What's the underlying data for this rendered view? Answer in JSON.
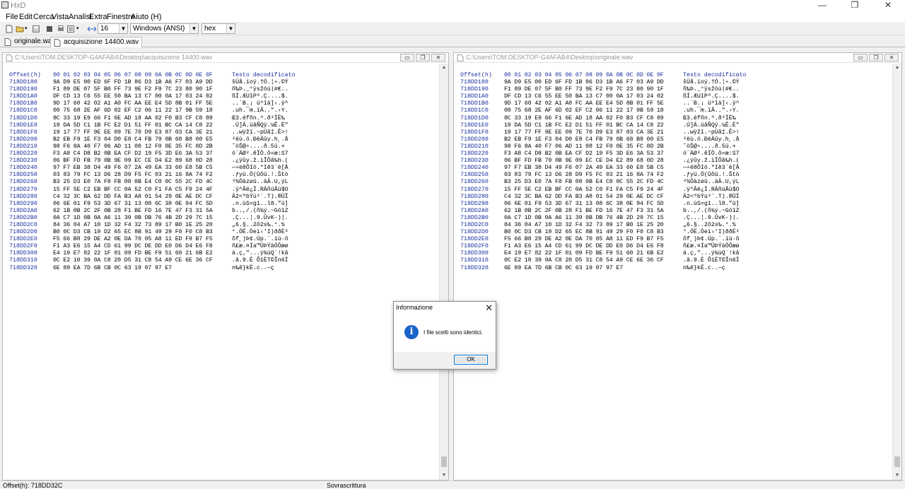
{
  "window": {
    "title": "HxD",
    "minimize": "—",
    "maximize": "❐",
    "close": "✕"
  },
  "menu": [
    "File",
    "Edit",
    "Cerca",
    "Vista",
    "Analisi",
    "Extra",
    "Finestre",
    "Aiuto (H)"
  ],
  "toolbar": {
    "bytes_per_row": "16",
    "charset": "Windows (ANSI)",
    "offset_base": "hex"
  },
  "tabs": [
    {
      "label": "originale.wav",
      "active": false
    },
    {
      "label": "acquisizione 14400.wav",
      "active": true
    }
  ],
  "panes": {
    "left": {
      "path": "C:\\Users\\TOM.DESKTOP-G4AFAB4\\Desktop\\acquisizione 14400.wav"
    },
    "right": {
      "path": "C:\\Users\\TOM.DESKTOP-G4AFAB4\\Desktop\\originale.wav"
    }
  },
  "hex_header": {
    "offset": "Offset(h)",
    "columns": "00 01 02 03 04 05 06 07 08 09 0A 0B 0C 0D 0E 0F",
    "text": "Testo decodificato"
  },
  "hex_rows": [
    {
      "offset": "718DD180",
      "bytes": "9A D9 E5 00 ED 6F FD 1B 86 D3 1B A6 F7 03 A9 DD",
      "text": "šÙå.íoý.†Ó.¦÷.©Ý"
    },
    {
      "offset": "718DD190",
      "bytes": "F1 89 DE 07 5F B0 FF 73 9E F2 F9 7C 23 80 90 1F",
      "text": "ñ‰Þ._°ÿsžòù|#€.."
    },
    {
      "offset": "718DD1A0",
      "bytes": "DF CD 13 C6 55 EE 50 BA 13 C7 00 0A 17 03 24 02",
      "text": "ßÍ.ÆUîPº.Ç....$."
    },
    {
      "offset": "718DD1B0",
      "bytes": "9D 17 60 42 02 A1 A0 FC AA EE E4 5D 8B 01 FF 5E",
      "text": "..`B.¡ üªîä]‹.ÿ^"
    },
    {
      "offset": "718DD1C0",
      "bytes": "00 75 68 2E AF 6D 02 EF C2 06 11 22 17 9B 59 18",
      "text": ".uh.¯m.ïÂ..\".›Y."
    },
    {
      "offset": "718DD1D0",
      "bytes": "8C 33 19 E9 66 F1 6E AD 18 AA 02 F0 B3 CF C8 89",
      "text": "Œ3.éfñn­.ª.ð³ÏÈ‰"
    },
    {
      "offset": "718DD1E0",
      "bytes": "19 DA 5D C1 1B FC E2 D1 51 FF 01 BC CA 14 C8 22",
      "text": ".Ú]Á.üâÑQÿ.¼Ê.È\""
    },
    {
      "offset": "718DD1F0",
      "bytes": "19 17 77 FF 9E EE 09 7E 70 D9 E3 87 03 CA 3E 21",
      "text": "..wÿžî.~pÙã‡.Ê>!"
    },
    {
      "offset": "718DD200",
      "bytes": "B2 EB F9 1E F3 04 D0 E8 C4 FB 79 0B 68 B8 00 E5",
      "text": "²ëù.ó.ÐèÄûy.h¸.å"
    },
    {
      "offset": "718DD210",
      "bytes": "98 F6 8A 40 F7 06 AD 11 08 12 F0 0E 35 FC 8D 2B",
      "text": "˜öŠ@÷.­...ð.5ü.+"
    },
    {
      "offset": "718DD220",
      "bytes": "F3 A8 C4 D8 B2 0B EA CF D2 19 F5 3D E6 3A 53 37",
      "text": "ó¨ÄØ².êÏÒ.õ=æ:S7"
    },
    {
      "offset": "718DD230",
      "bytes": "06 BF FD FB 79 0B 9E 09 EC CE D4 E2 89 68 0D 28",
      "text": ".¿ýûy.ž.ìÎÔâ‰h.("
    },
    {
      "offset": "718DD240",
      "bytes": "97 F7 EB 38 D4 49 F6 07 2A 49 EA 33 60 E8 5B C5",
      "text": "—÷ë8ÔIö.*Iê3`è[Å"
    },
    {
      "offset": "718DD250",
      "bytes": "03 83 79 FC 13 D6 28 D9 F5 FC 03 21 16 8A 74 F2",
      "text": ".ƒyü.Ö(Ùõü.!.Štò"
    },
    {
      "offset": "718DD260",
      "bytes": "B3 25 D3 E0 7A F8 FB 08 0B E4 C0 0C 55 2C FD 4C",
      "text": "³%Óàzøû..äÀ.U,ýL"
    },
    {
      "offset": "718DD270",
      "bytes": "15 FF 5E C2 EB BF CC 0A 52 C0 F1 FA C5 F9 24 4F",
      "text": ".ÿ^Âë¿Ì.RÀñúÅù$O"
    },
    {
      "offset": "718DD280",
      "bytes": "C4 32 3C BA 62 DD FA B3 A8 01 54 29 0E AE DC CF",
      "text": "Ä2<ºbÝú³¨.T).®ÜÏ"
    },
    {
      "offset": "718DD290",
      "bytes": "06 6E 01 F9 53 3D 67 31 13 08 6C 38 0E 94 FC 5D",
      "text": ".n.ùS=g1..l8.”ü]"
    },
    {
      "offset": "718DD2A0",
      "bytes": "62 1B 0B 2C 2F 0B 28 F1 BE FD 16 7E 47 F3 31 5A",
      "text": "b..,/.(ñ¾ý.~Gó1Z"
    },
    {
      "offset": "718DD2B0",
      "bytes": "0A C7 1D 0B 0A A6 11 39 0B DB 76 4B 2D 29 7C 15",
      "text": ".Ç...¦.9.ÛvK-)|."
    },
    {
      "offset": "718DD2C0",
      "bytes": "84 36 04 A7 10 1D 32 F4 32 73 89 17 B0 1E 25 20",
      "text": "„6.§..2ô2s‰.°.% "
    },
    {
      "offset": "718DD2D0",
      "bytes": "B0 0C D3 CB 19 D2 65 EC 8B 91 49 29 F0 F0 C8 B3",
      "text": "°.ÓË.Òeì‹'I)ððÈ³"
    },
    {
      "offset": "718DD2E0",
      "bytes": "F5 66 B8 29 DE A2 0E DA 70 05 A8 11 ED F9 B7 F5",
      "text": "õf¸)Þ¢.Úp.¨.íù·õ"
    },
    {
      "offset": "718DD2F0",
      "bytes": "F1 A3 E6 15 A4 CD 61 99 DC DE DD E0 D6 D4 E6 F8",
      "text": "ñ£æ.¤Ía™ÜÞÝàÖÔæø"
    },
    {
      "offset": "718DD300",
      "bytes": "E4 19 E7 82 22 1F 01 09 FD BE F9 51 60 21 6B E2",
      "text": "ä.ç‚\"...ý¾ùQ`!kâ"
    },
    {
      "offset": "718DD310",
      "bytes": "0C E2 10 39 0A C8 20 D5 31 C8 54 A9 CE 6E 36 CF",
      "text": ".â.9.È Õ1ÈT©În6Ï"
    },
    {
      "offset": "718DD320",
      "bytes": "6E 89 EA 7D 6B CB 0C 63 19 07 97 E7",
      "text": "n‰ê}kË.c..—ç"
    }
  ],
  "status": {
    "offset": "Offset(h): 718DD32C",
    "mode": "Sovrascrittura"
  },
  "dialog": {
    "title": "Informazione",
    "close": "✕",
    "icon": "i",
    "message": "I file scelti sono identici.",
    "ok": "OK"
  }
}
